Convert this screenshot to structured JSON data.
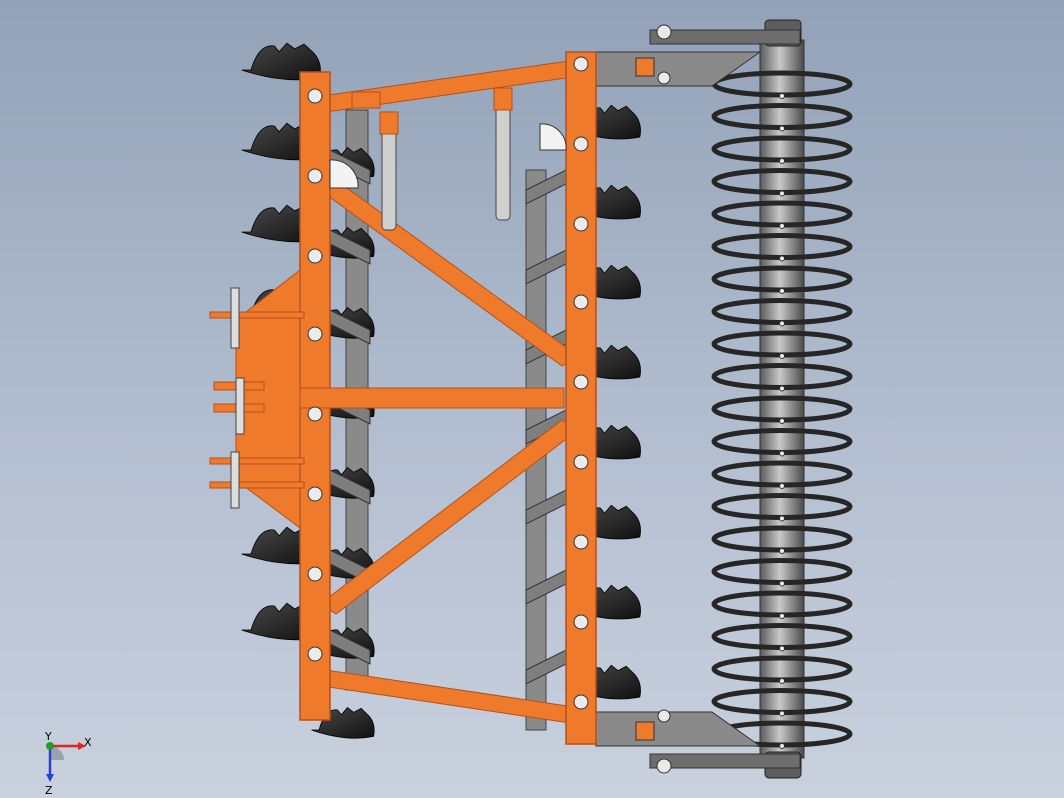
{
  "viewport": {
    "background_top": "#93a2b8",
    "background_bottom": "#c9d1de"
  },
  "colors": {
    "frame_orange": "#f07a2c",
    "frame_dark": "#b4501a",
    "disc_black": "#1c1c1c",
    "roller_grey": "#6f6f6f",
    "spring_dark": "#2e2e2e",
    "bracket_grey": "#8a8a8a"
  },
  "triad": {
    "x_label": "X",
    "y_label": "Y",
    "z_label": "Z",
    "x_color": "#e3261c",
    "y_color": "#1fa02a",
    "z_color": "#2a3fd6"
  }
}
